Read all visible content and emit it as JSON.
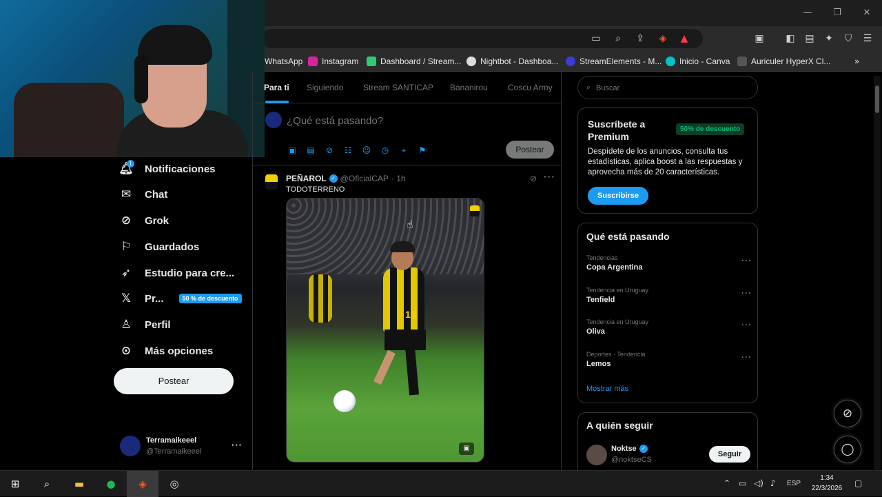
{
  "window": {
    "minimize": "—",
    "restore": "❐",
    "close": "✕"
  },
  "bookmarks": [
    {
      "label": "WhatsApp",
      "color": "#25d366"
    },
    {
      "label": "Instagram",
      "color": "#d6249f"
    },
    {
      "label": "Dashboard / Stream...",
      "color": "#2ecc71"
    },
    {
      "label": "Nightbot - Dashboa...",
      "color": "#dddddd"
    },
    {
      "label": "StreamElements - M...",
      "color": "#3b3bdb"
    },
    {
      "label": "Inicio - Canva",
      "color": "#00c4cc"
    },
    {
      "label": "Auriculer HyperX Cl...",
      "color": "#555555"
    }
  ],
  "nav": {
    "items": [
      {
        "label": "Notificaciones",
        "icon": "bell-icon"
      },
      {
        "label": "Chat",
        "icon": "mail-icon"
      },
      {
        "label": "Grok",
        "icon": "grok-icon"
      },
      {
        "label": "Guardados",
        "icon": "bookmark-icon"
      },
      {
        "label": "Estudio para cre...",
        "icon": "rocket-icon"
      },
      {
        "label": "Pr...",
        "icon": "x-logo-icon",
        "badge": "50 % de descuento"
      },
      {
        "label": "Perfil",
        "icon": "person-icon"
      },
      {
        "label": "Más opciones",
        "icon": "more-circle-icon"
      }
    ],
    "notification_count": "1",
    "post_button": "Postear",
    "account": {
      "name": "Terramaikeeel",
      "handle": "@Terramaikeeel"
    }
  },
  "tabs": [
    "Para ti",
    "Siguiendo",
    "Stream SANTICAP",
    "Bananirou",
    "Coscu Army"
  ],
  "compose": {
    "placeholder": "¿Qué está pasando?",
    "post_button": "Postear"
  },
  "tweet": {
    "name": "PEÑAROL",
    "handle": "@OficialCAP",
    "time": "· 1h",
    "text": "TODOTERRENO",
    "jersey_number": "13"
  },
  "search": {
    "placeholder": "Buscar"
  },
  "premium": {
    "title": "Suscríbete a Premium",
    "badge": "50% de descuento",
    "description": "Despídete de los anuncios, consulta tus estadísticas, aplica boost a las respuestas y aprovecha más de 20 características.",
    "button": "Suscribirse"
  },
  "trends": {
    "title": "Qué está pasando",
    "items": [
      {
        "context": "Tendencias",
        "name": "Copa Argentina"
      },
      {
        "context": "Tendencia en Uruguay",
        "name": "Tenfield"
      },
      {
        "context": "Tendencia en Uruguay",
        "name": "Oliva"
      },
      {
        "context": "Deportes · Tendencia",
        "name": "Lemos"
      }
    ],
    "show_more": "Mostrar más"
  },
  "who_to_follow": {
    "title": "A quién seguir",
    "name": "Noktse",
    "handle": "@noktseCS",
    "button": "Seguir"
  },
  "taskbar": {
    "language": "ESP",
    "time": "1:34",
    "date": "22/3/2026"
  },
  "colors": {
    "accent": "#1d9bf0",
    "background": "#000000",
    "border": "#2f3336",
    "premium_green": "#00ba7c"
  }
}
